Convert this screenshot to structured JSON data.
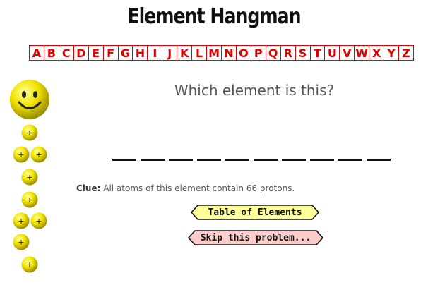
{
  "title": "Element Hangman",
  "alphabet": [
    "A",
    "B",
    "C",
    "D",
    "E",
    "F",
    "G",
    "H",
    "I",
    "J",
    "K",
    "L",
    "M",
    "N",
    "O",
    "P",
    "Q",
    "R",
    "S",
    "T",
    "U",
    "V",
    "W",
    "X",
    "Y",
    "Z"
  ],
  "question": "Which element is this?",
  "answer_length": 10,
  "clue": {
    "label": "Clue:",
    "text": "All atoms of this element contain 66 protons."
  },
  "buttons": {
    "table_label": "Table of Elements",
    "skip_label": "Skip this problem..."
  },
  "nucleus_symbol": "+",
  "colors": {
    "letters": "#e00000",
    "table_button": "#ffff99",
    "skip_button": "#ffcccc",
    "ball": "#f2e400"
  }
}
